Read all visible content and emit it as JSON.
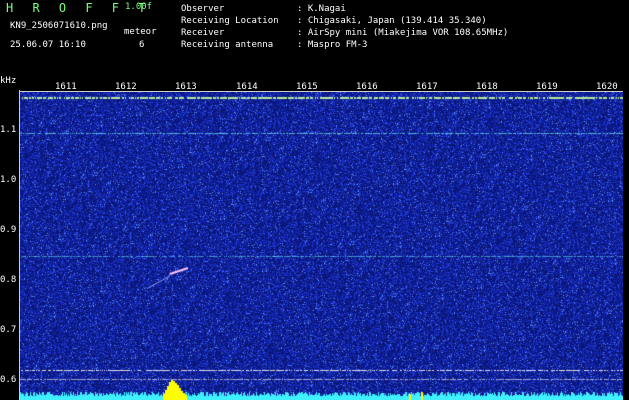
{
  "header": {
    "app_title": "H R O F F T",
    "version": "1.00f",
    "filename": "KN9_2506071610.png",
    "datetime": "25.06.07 16:10",
    "meteor_label": "meteor",
    "meteor_count": "6"
  },
  "info": [
    {
      "label": "Observer",
      "value": ": K.Nagai"
    },
    {
      "label": "Receiving Location",
      "value": ": Chigasaki, Japan (139.414 35.340)"
    },
    {
      "label": "Receiver",
      "value": ": AirSpy mini (Miakejima VOR 108.65MHz)"
    },
    {
      "label": "Receiving antenna",
      "value": ": Maspro FM-3"
    }
  ],
  "axes": {
    "y_unit": "kHz",
    "y_ticks": [
      "1.1",
      "1.0",
      "0.9",
      "0.8",
      "0.7",
      "0.6"
    ],
    "time_ticks": [
      "1611",
      "1612",
      "1613",
      "1614",
      "1615",
      "1616",
      "1617",
      "1618",
      "1619",
      "1620"
    ]
  },
  "colors": {
    "background_noise": "#1a2aa8",
    "signal_line": "#6ef0ff",
    "meteor_echo": "#ffd0ff",
    "bottom_band": "#3ff0ff",
    "burst": "#ffff00"
  }
}
